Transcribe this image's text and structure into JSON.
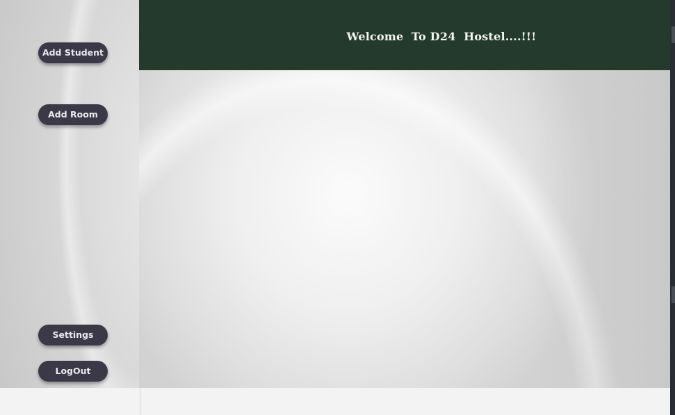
{
  "header": {
    "title": "Welcome  To D24  Hostel....!!!"
  },
  "sidebar": {
    "buttons": [
      {
        "label": "Add Student"
      },
      {
        "label": "Add Room"
      },
      {
        "label": "Settings"
      },
      {
        "label": "LogOut"
      }
    ]
  },
  "colors": {
    "header_bg": "#243a2d",
    "button_bg": "#3b3847",
    "button_text": "#e9e9ef"
  }
}
